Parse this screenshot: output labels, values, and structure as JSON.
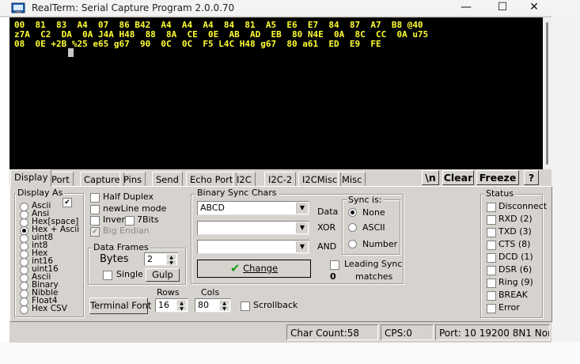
{
  "window": {
    "title": "RealTerm: Serial Capture Program 2.0.0.70",
    "minimize": "—",
    "maximize": "☐",
    "close": "✕"
  },
  "terminal": {
    "lines": [
      "00  81  83  A4  07  86 B42  A4  A4  A4  84  81  A5  E6  E7  84  87  A7  B8 @40",
      "z7A  C2  DA  0A J4A H48  88  8A  CE  0E  AB  AD  EB  80 N4E  0A  8C  CC  0A u75",
      "08  0E +2B %25 e65 g67  90  0C  0C  F5 L4C H48 g67  80 a61  ED  E9  FE"
    ],
    "text_color": "#ffff33",
    "bg_color": "#000000"
  },
  "tabs": [
    "Display",
    "Port",
    "Capture",
    "Pins",
    "Send",
    "Echo Port",
    "I2C",
    "I2C-2",
    "I2CMisc",
    "Misc"
  ],
  "top_buttons": {
    "newline": "\\n",
    "clear": "Clear",
    "freeze": "Freeze",
    "help": "?"
  },
  "display_as": {
    "title": "Display As",
    "options": [
      "Ascii",
      "Ansi",
      "Hex[space]",
      "Hex + Ascii",
      "uint8",
      "int8",
      "Hex",
      "int16",
      "uint16",
      "Ascii",
      "Binary",
      "Nibble",
      "Float4",
      "Hex CSV"
    ],
    "selected": "Hex + Ascii"
  },
  "options": {
    "half_duplex": "Half Duplex",
    "newline_mode": "newLine mode",
    "invert": "Invert",
    "seven_bits": "7Bits",
    "big_endian": "Big Endian"
  },
  "data_frames": {
    "title": "Data Frames",
    "bytes_label": "Bytes",
    "bytes_value": "2",
    "single_label": "Single",
    "gulp_label": "Gulp"
  },
  "binary_sync": {
    "title": "Binary Sync Chars",
    "data_value": "ABCD",
    "data_label": "Data",
    "xor_label": "XOR",
    "and_label": "AND",
    "change_label": "Change",
    "sync_is": {
      "title": "Sync is:",
      "options": [
        "None",
        "ASCII",
        "Number"
      ],
      "selected": "None"
    },
    "leading_sync": "Leading Sync",
    "matches": "matches",
    "count": "0"
  },
  "terminal_font_label": "Terminal Font",
  "rows": {
    "label": "Rows",
    "value": "16"
  },
  "cols": {
    "label": "Cols",
    "value": "80"
  },
  "scrollback_label": "Scrollback",
  "status": {
    "title": "Status",
    "items": [
      "Disconnect",
      "RXD (2)",
      "TXD (3)",
      "CTS (8)",
      "DCD (1)",
      "DSR (6)",
      "Ring (9)",
      "BREAK",
      "Error"
    ]
  },
  "statusbar": {
    "char_count": "Char Count:58",
    "cps": "CPS:0",
    "port": "Port: 10 19200 8N1 Non"
  },
  "colors": {
    "accent_green": "#1a9a1a",
    "window_bg": "#d6d3ce"
  }
}
